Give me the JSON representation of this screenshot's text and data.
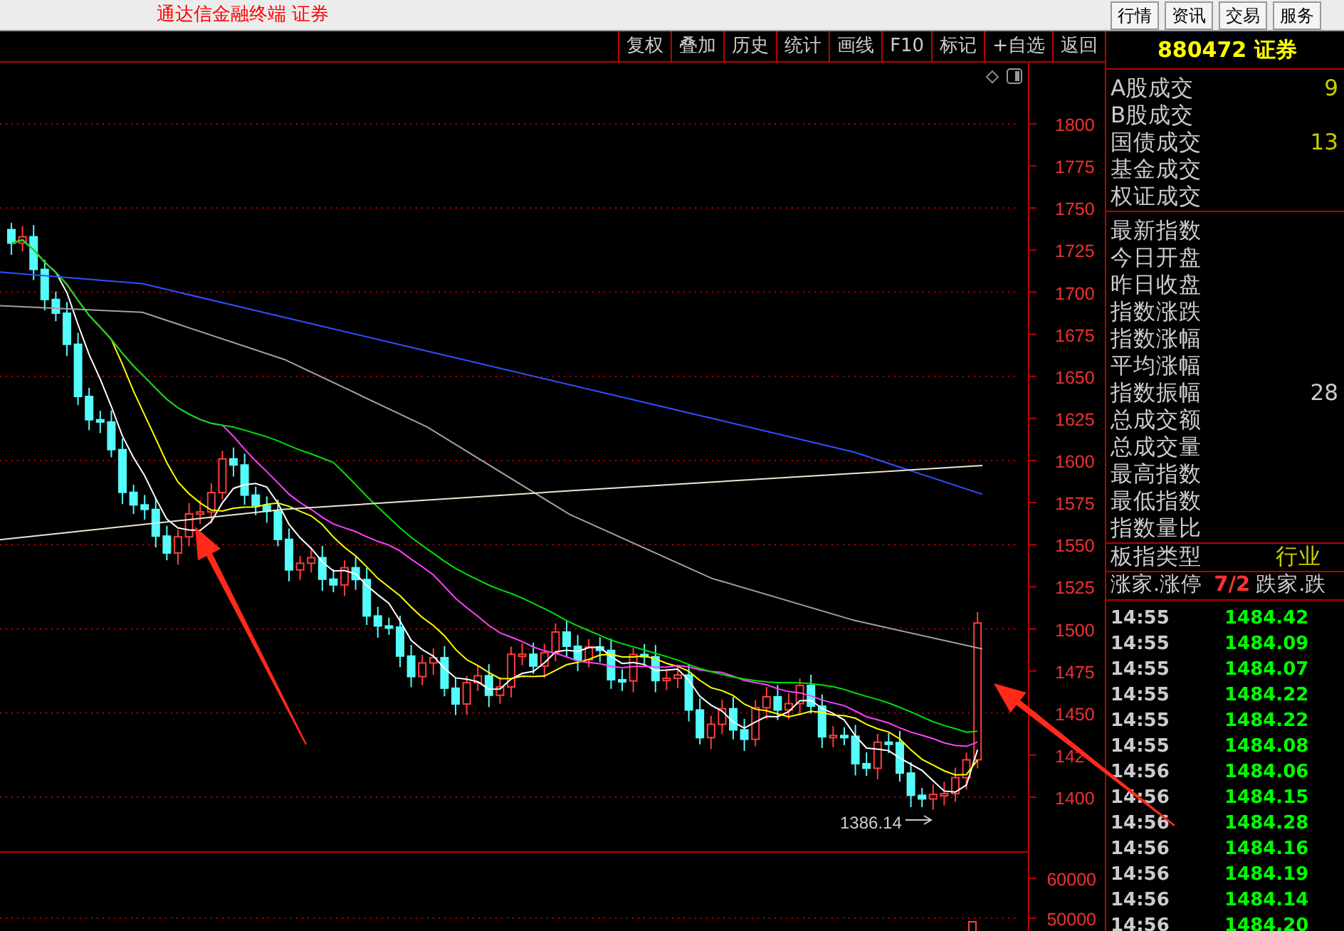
{
  "title_bar": {
    "title": "通达信金融终端 证券",
    "menu_buttons": [
      "行情",
      "资讯",
      "交易",
      "服务"
    ]
  },
  "toolbar": {
    "buttons": [
      "复权",
      "叠加",
      "历史",
      "统计",
      "画线",
      "F10",
      "标记",
      "+自选",
      "返回"
    ]
  },
  "chart": {
    "price_ticks": [
      "1800",
      "1775",
      "1750",
      "1725",
      "1700",
      "1675",
      "1650",
      "1625",
      "1600",
      "1575",
      "1550",
      "1525",
      "1500",
      "1475",
      "1450",
      "142",
      "1400"
    ],
    "volume_ticks": [
      "60000",
      "50000"
    ],
    "low_marker": "1386.14"
  },
  "quote_panel": {
    "header": "880472 证券",
    "turnover_rows": [
      {
        "label": "A股成交",
        "value": "9"
      },
      {
        "label": "B股成交",
        "value": ""
      },
      {
        "label": "国债成交",
        "value": "13"
      },
      {
        "label": "基金成交",
        "value": ""
      },
      {
        "label": "权证成交",
        "value": ""
      }
    ],
    "index_rows": [
      {
        "label": "最新指数",
        "value": ""
      },
      {
        "label": "今日开盘",
        "value": ""
      },
      {
        "label": "昨日收盘",
        "value": ""
      },
      {
        "label": "指数涨跌",
        "value": ""
      },
      {
        "label": "指数涨幅",
        "value": ""
      },
      {
        "label": "平均涨幅",
        "value": ""
      },
      {
        "label": "指数振幅",
        "value": "28"
      },
      {
        "label": "总成交额",
        "value": ""
      },
      {
        "label": "总成交量",
        "value": ""
      },
      {
        "label": "最高指数",
        "value": ""
      },
      {
        "label": "最低指数",
        "value": ""
      },
      {
        "label": "指数量比",
        "value": ""
      }
    ],
    "board_type": {
      "label": "板指类型",
      "value": "行业"
    },
    "breadth": {
      "label": "涨家.涨停",
      "value": "7/2",
      "label_2": "跌家.跌"
    },
    "ticks": [
      {
        "time": "14:55",
        "price": "1484.42"
      },
      {
        "time": "14:55",
        "price": "1484.09"
      },
      {
        "time": "14:55",
        "price": "1484.07"
      },
      {
        "time": "14:55",
        "price": "1484.22"
      },
      {
        "time": "14:55",
        "price": "1484.22"
      },
      {
        "time": "14:55",
        "price": "1484.08"
      },
      {
        "time": "14:56",
        "price": "1484.06"
      },
      {
        "time": "14:56",
        "price": "1484.15"
      },
      {
        "time": "14:56",
        "price": "1484.28"
      },
      {
        "time": "14:56",
        "price": "1484.16"
      },
      {
        "time": "14:56",
        "price": "1484.19"
      },
      {
        "time": "14:56",
        "price": "1484.14"
      },
      {
        "time": "14:56",
        "price": "1484.20"
      }
    ]
  }
}
